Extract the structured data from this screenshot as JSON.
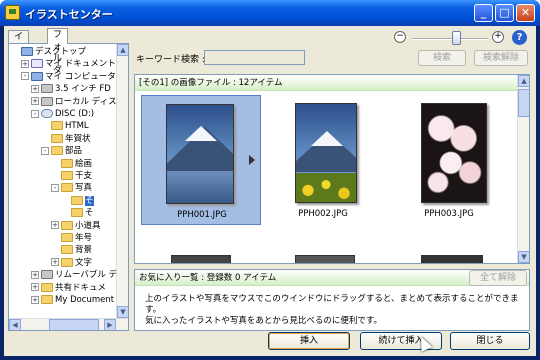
{
  "window": {
    "title": "イラストセンター",
    "controls": {
      "minimize": "_",
      "maximize": "□",
      "close": "✕"
    }
  },
  "tabs": [
    {
      "label": "イラスト"
    },
    {
      "label": "フォルダ"
    }
  ],
  "tree": [
    {
      "label": "デスクトップ",
      "icon": "desktop-icon",
      "expander": "",
      "indent": 0
    },
    {
      "label": "マイ ドキュメント",
      "icon": "my-documents-icon",
      "expander": "+",
      "indent": 1
    },
    {
      "label": "マイ コンピュータ",
      "icon": "my-computer-icon",
      "expander": "-",
      "indent": 1
    },
    {
      "label": "3.5 インチ FD",
      "icon": "floppy-drive-icon",
      "expander": "+",
      "indent": 2
    },
    {
      "label": "ローカル ディス",
      "icon": "local-disk-icon",
      "expander": "+",
      "indent": 2
    },
    {
      "label": "DISC (D:)",
      "icon": "cd-drive-icon",
      "expander": "-",
      "indent": 2
    },
    {
      "label": "HTML",
      "icon": "folder-icon",
      "expander": "",
      "indent": 3
    },
    {
      "label": "年賀状",
      "icon": "folder-icon",
      "expander": "",
      "indent": 3
    },
    {
      "label": "部品",
      "icon": "folder-icon",
      "expander": "-",
      "indent": 3
    },
    {
      "label": "絵画",
      "icon": "folder-icon",
      "expander": "",
      "indent": 4
    },
    {
      "label": "干支",
      "icon": "folder-icon",
      "expander": "",
      "indent": 4
    },
    {
      "label": "写真",
      "icon": "folder-icon",
      "expander": "-",
      "indent": 4
    },
    {
      "label": "そ",
      "icon": "folder-icon",
      "expander": "",
      "indent": 5,
      "selected": true
    },
    {
      "label": "そ",
      "icon": "folder-icon",
      "expander": "",
      "indent": 5
    },
    {
      "label": "小道具",
      "icon": "folder-icon",
      "expander": "+",
      "indent": 4
    },
    {
      "label": "年号",
      "icon": "folder-icon",
      "expander": "",
      "indent": 4
    },
    {
      "label": "背景",
      "icon": "folder-icon",
      "expander": "",
      "indent": 4
    },
    {
      "label": "文字",
      "icon": "folder-icon",
      "expander": "+",
      "indent": 4
    },
    {
      "label": "リムーバブル デ",
      "icon": "removable-drive-icon",
      "expander": "+",
      "indent": 2
    },
    {
      "label": "共有ドキュメ",
      "icon": "folder-icon",
      "expander": "+",
      "indent": 2
    },
    {
      "label": "My Document",
      "icon": "folder-icon",
      "expander": "+",
      "indent": 2
    }
  ],
  "zoom": {
    "minus": "−",
    "plus": "+",
    "help": "?",
    "level": 0.58
  },
  "search": {
    "label": "キーワード検索 :",
    "value": "",
    "button": "検索",
    "clear_button": "検索解除"
  },
  "gallery": {
    "header": "[その1] の画像ファイル : 12アイテム",
    "items": [
      {
        "caption": "PPH001.JPG",
        "selected": true,
        "picture": "mountain-lake"
      },
      {
        "caption": "PPH002.JPG",
        "selected": false,
        "picture": "mountain-flowers"
      },
      {
        "caption": "PPH003.JPG",
        "selected": false,
        "picture": "cherry-blossom"
      }
    ]
  },
  "favorites": {
    "header": "お気に入り一覧 : 登録数 0 アイテム",
    "clear_button": "全て解除",
    "description_line1": "上のイラストや写真をマウスでこのウインドウにドラッグすると、まとめて表示することができます。",
    "description_line2": "気に入ったイラストや写真をあとから見比べるのに便利です。"
  },
  "buttons": {
    "insert": "挿入",
    "insert_continue": "続けて挿入",
    "close": "閉じる"
  },
  "colors": {
    "titlebar": "#0050d8",
    "selection": "#316ac5",
    "header_green": "#d6efc8"
  }
}
